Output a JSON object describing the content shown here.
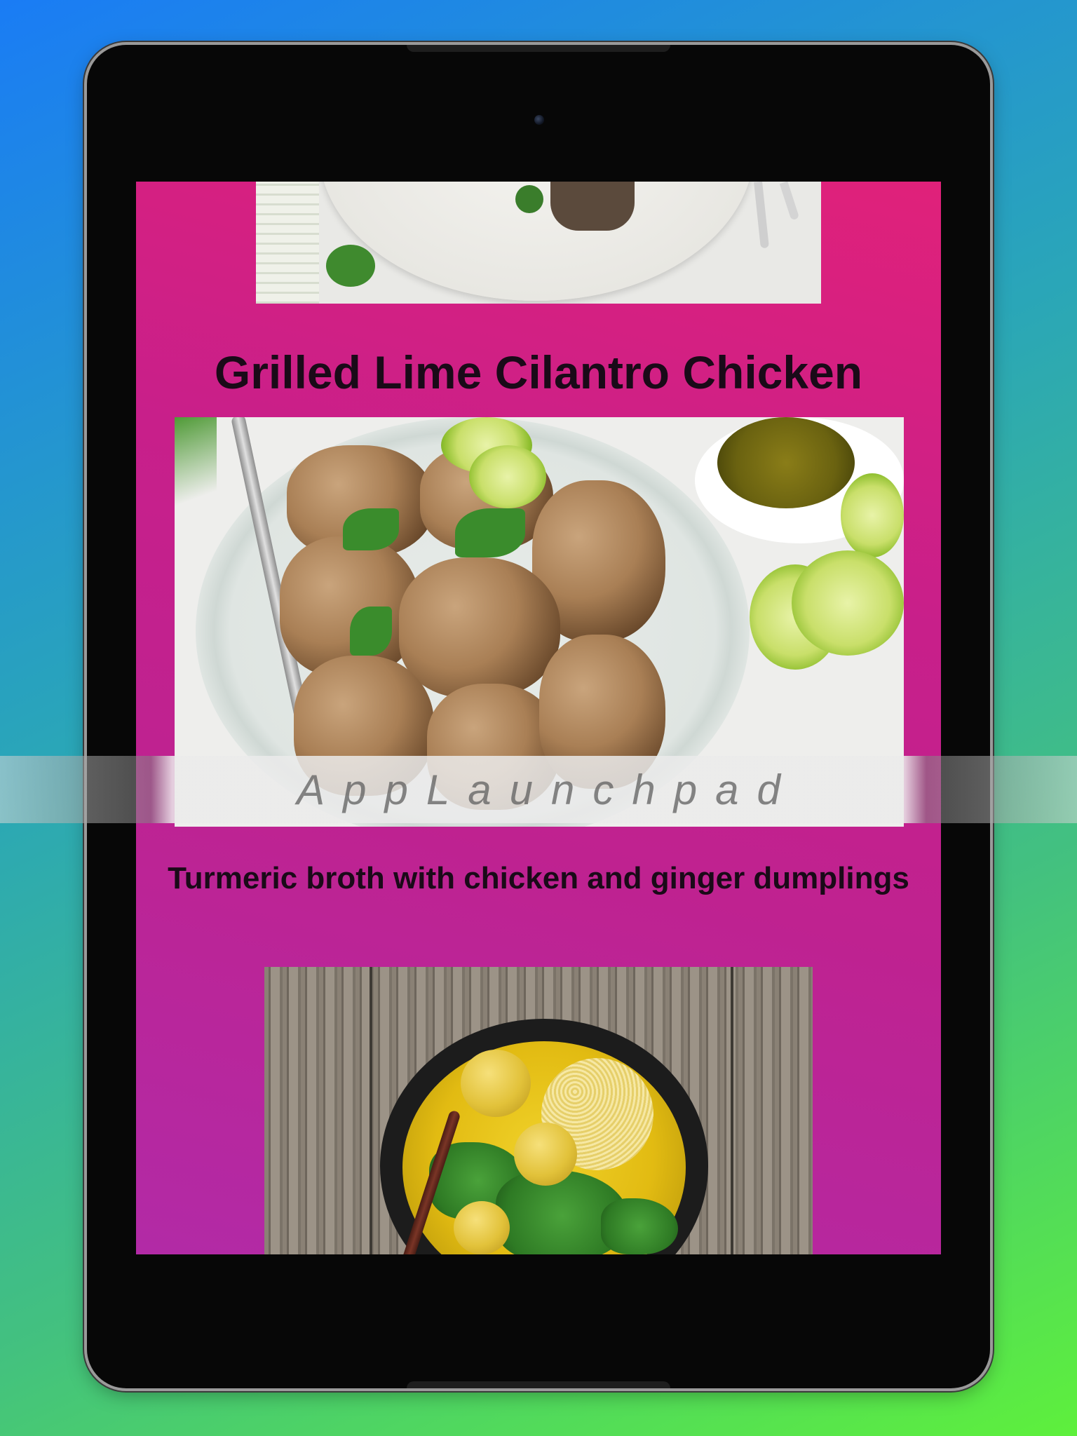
{
  "feed": {
    "items": [
      {
        "title": "",
        "image": "grilled-meat-plate-photo"
      },
      {
        "title": "Grilled Lime Cilantro Chicken",
        "image": "grilled-lime-cilantro-chicken-photo"
      },
      {
        "title": "Turmeric broth with chicken and ginger dumplings",
        "image": "turmeric-broth-soup-photo"
      }
    ]
  },
  "watermark": {
    "text": "AppLaunchpad"
  },
  "colors": {
    "background_gradient_start": "#1a7cf5",
    "background_gradient_end": "#5ef03c",
    "screen_gradient_start": "#e0217a",
    "screen_gradient_end": "#b22aa6",
    "title_text": "#1a0a18",
    "device_bezel": "#070707"
  }
}
